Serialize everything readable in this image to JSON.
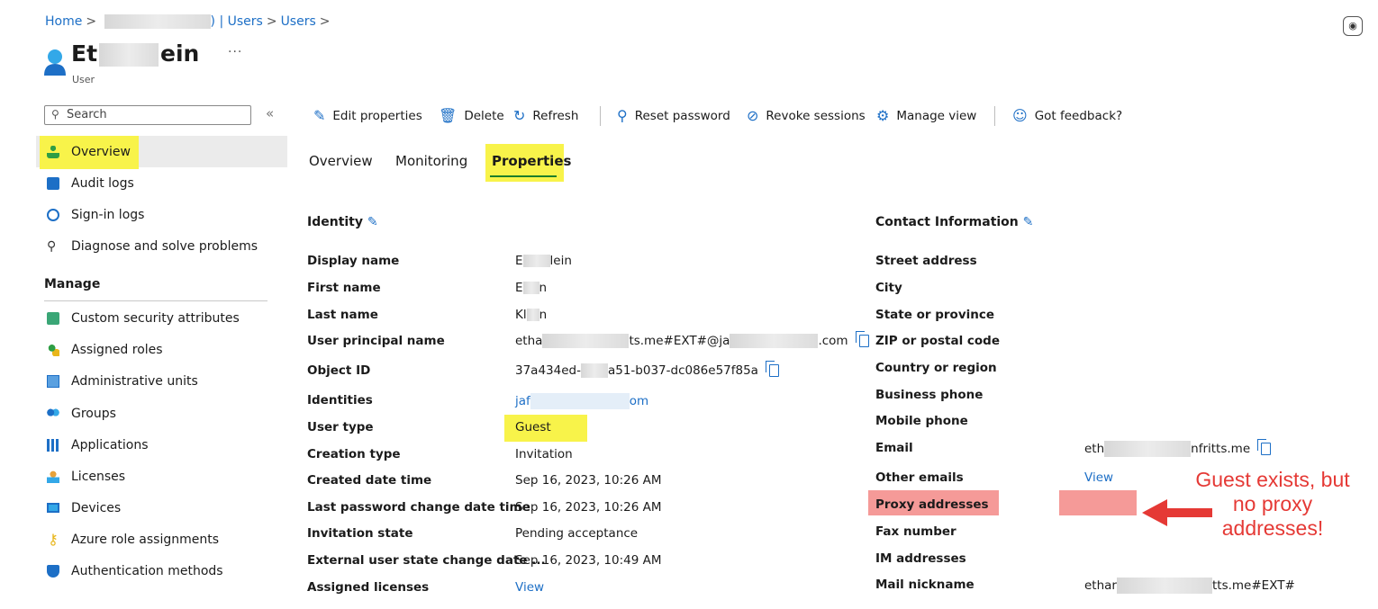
{
  "breadcrumb": {
    "home": "Home",
    "tenant_suffix": ") | Users",
    "users": "Users"
  },
  "header": {
    "title_prefix": "Et",
    "title_suffix": "ein",
    "more": "···",
    "subtitle": "User"
  },
  "sidebar": {
    "search_placeholder": "Search",
    "collapse": "«",
    "items": [
      {
        "label": "Overview",
        "icon": "user-icon"
      },
      {
        "label": "Audit logs",
        "icon": "audit-log-icon"
      },
      {
        "label": "Sign-in logs",
        "icon": "sign-in-icon"
      },
      {
        "label": "Diagnose and solve problems",
        "icon": "wrench-icon"
      }
    ],
    "manage_heading": "Manage",
    "manage_items": [
      {
        "label": "Custom security attributes",
        "icon": "security-attributes-icon"
      },
      {
        "label": "Assigned roles",
        "icon": "roles-icon"
      },
      {
        "label": "Administrative units",
        "icon": "admin-units-icon"
      },
      {
        "label": "Groups",
        "icon": "groups-icon"
      },
      {
        "label": "Applications",
        "icon": "applications-grid-icon"
      },
      {
        "label": "Licenses",
        "icon": "licenses-icon"
      },
      {
        "label": "Devices",
        "icon": "devices-icon"
      },
      {
        "label": "Azure role assignments",
        "icon": "key-icon"
      },
      {
        "label": "Authentication methods",
        "icon": "shield-icon"
      }
    ]
  },
  "toolbar": {
    "edit": "Edit properties",
    "delete": "Delete",
    "refresh": "Refresh",
    "reset_password": "Reset password",
    "revoke_sessions": "Revoke sessions",
    "manage_view": "Manage view",
    "feedback": "Got feedback?"
  },
  "tabs": [
    "Overview",
    "Monitoring",
    "Properties"
  ],
  "identity": {
    "heading": "Identity",
    "rows": [
      {
        "label": "Display name",
        "value_a": "E",
        "value_b": "lein"
      },
      {
        "label": "First name",
        "value_a": "E",
        "value_b": "n"
      },
      {
        "label": "Last name",
        "value_a": "Kl",
        "value_b": "n"
      },
      {
        "label": "User principal name",
        "value_a": "etha",
        "value_b": "ts.me#EXT#@ja",
        "value_c": ".com"
      },
      {
        "label": "Object ID",
        "value_a": "37a434ed-",
        "value_b": "a51-b037-dc086e57f85a"
      },
      {
        "label": "Identities",
        "value_a": "jaf",
        "value_b": "om"
      },
      {
        "label": "User type",
        "value": "Guest"
      },
      {
        "label": "Creation type",
        "value": "Invitation"
      },
      {
        "label": "Created date time",
        "value": "Sep 16, 2023, 10:26 AM"
      },
      {
        "label": "Last password change date time",
        "value": "Sep 16, 2023, 10:26 AM"
      },
      {
        "label": "Invitation state",
        "value": "Pending acceptance"
      },
      {
        "label": "External user state change date ...",
        "value": "Sep 16, 2023, 10:49 AM"
      },
      {
        "label": "Assigned licenses",
        "value": "View"
      }
    ]
  },
  "contact": {
    "heading": "Contact Information",
    "rows": [
      {
        "label": "Street address"
      },
      {
        "label": "City"
      },
      {
        "label": "State or province"
      },
      {
        "label": "ZIP or postal code"
      },
      {
        "label": "Country or region"
      },
      {
        "label": "Business phone"
      },
      {
        "label": "Mobile phone"
      },
      {
        "label": "Email",
        "value_a": "eth",
        "value_b": "nfritts.me"
      },
      {
        "label": "Other emails",
        "value": "View"
      },
      {
        "label": "Proxy addresses"
      },
      {
        "label": "Fax number"
      },
      {
        "label": "IM addresses"
      },
      {
        "label": "Mail nickname",
        "value_a": "ethar",
        "value_b": "tts.me#EXT#"
      }
    ]
  },
  "annotation": {
    "line1": "Guest exists, but",
    "line2": "no proxy",
    "line3": "addresses!"
  },
  "colors": {
    "highlight_yellow": "#f8f34a",
    "highlight_pink": "#f59a98",
    "annotation_red": "#e53935",
    "link_blue": "#1d6fc6"
  }
}
